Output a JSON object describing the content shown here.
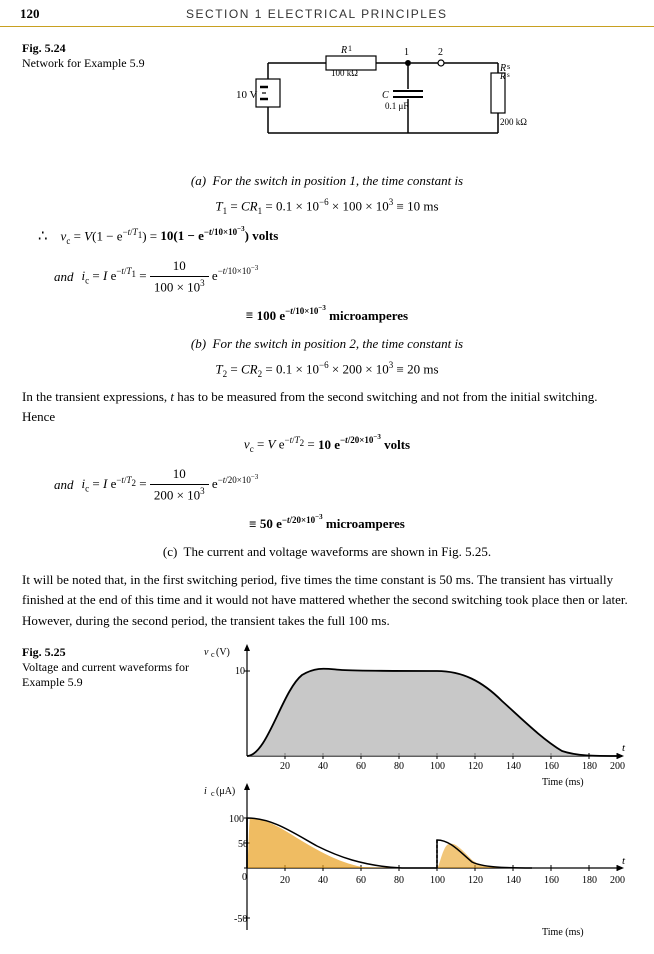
{
  "header": {
    "page_number": "120",
    "section": "SECTION 1   ELECTRICAL PRINCIPLES"
  },
  "fig24": {
    "label": "Fig. 5.24",
    "description": "Network for Example 5.9"
  },
  "fig25": {
    "label": "Fig. 5.25",
    "description": "Voltage and current waveforms for Example 5.9"
  },
  "parts": {
    "a_label": "(a)  For the switch in position 1, the time constant is",
    "b_label": "(b)  For the switch in position 2, the time constant is",
    "c_label": "(c)  The current and voltage waveforms are shown in Fig. 5.25."
  },
  "paragraph": "It will be noted that, in the first switching period, five times the time constant is 50 ms. The transient has virtually finished at the end of this time and it would not have mattered whether the second switching took place then or later. However, during the second period, the transient takes the full 100 ms."
}
